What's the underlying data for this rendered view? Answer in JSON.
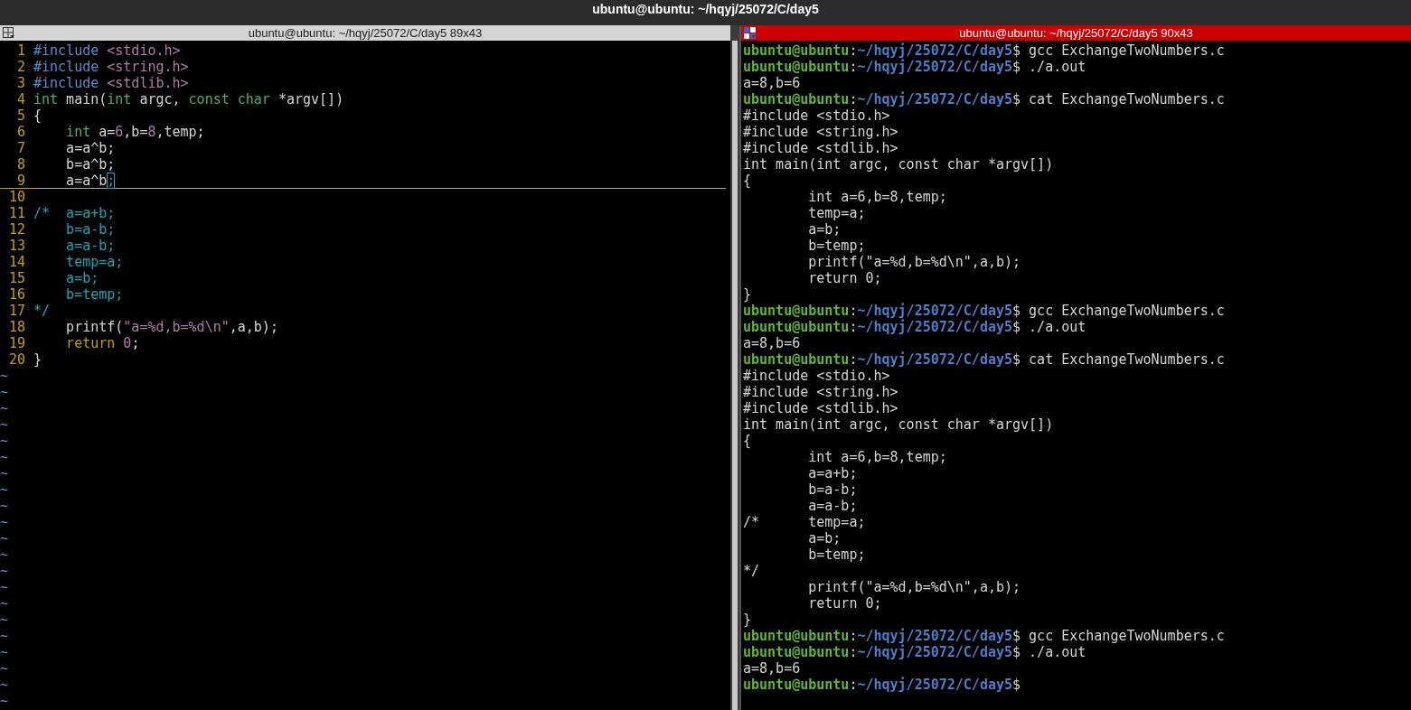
{
  "window": {
    "title": "ubuntu@ubuntu: ~/hqyj/25072/C/day5"
  },
  "panes": [
    {
      "kind": "editor",
      "title": "ubuntu@ubuntu: ~/hqyj/25072/C/day5 89x43",
      "active": false,
      "lines": [
        {
          "number": "1",
          "current": false,
          "segments": [
            {
              "text": "#include",
              "kind": "pre"
            },
            {
              "text": " <stdio.h>",
              "kind": "inc"
            }
          ]
        },
        {
          "number": "2",
          "current": false,
          "segments": [
            {
              "text": "#include",
              "kind": "pre"
            },
            {
              "text": " <string.h>",
              "kind": "inc"
            }
          ]
        },
        {
          "number": "3",
          "current": false,
          "segments": [
            {
              "text": "#include",
              "kind": "pre"
            },
            {
              "text": " <stdlib.h>",
              "kind": "inc"
            }
          ]
        },
        {
          "number": "4",
          "current": false,
          "segments": [
            {
              "text": "int",
              "kind": "type"
            },
            {
              "text": " main(",
              "kind": "plain"
            },
            {
              "text": "int",
              "kind": "type"
            },
            {
              "text": " argc, ",
              "kind": "plain"
            },
            {
              "text": "const char",
              "kind": "type"
            },
            {
              "text": " *argv[])",
              "kind": "plain"
            }
          ]
        },
        {
          "number": "5",
          "current": false,
          "segments": [
            {
              "text": "{",
              "kind": "plain"
            }
          ]
        },
        {
          "number": "6",
          "current": false,
          "segments": [
            {
              "text": "    int",
              "kind": "type"
            },
            {
              "text": " a=",
              "kind": "plain"
            },
            {
              "text": "6",
              "kind": "num"
            },
            {
              "text": ",b=",
              "kind": "plain"
            },
            {
              "text": "8",
              "kind": "num"
            },
            {
              "text": ",temp;",
              "kind": "plain"
            }
          ]
        },
        {
          "number": "7",
          "current": false,
          "segments": [
            {
              "text": "    a=a^b;",
              "kind": "plain"
            }
          ]
        },
        {
          "number": "8",
          "current": false,
          "segments": [
            {
              "text": "    b=a^b;",
              "kind": "plain"
            }
          ]
        },
        {
          "number": "9",
          "current": true,
          "segments": [
            {
              "text": "    a=a^b",
              "kind": "plain"
            },
            {
              "text": ";",
              "kind": "cursor"
            }
          ]
        },
        {
          "number": "10",
          "current": false
        },
        {
          "number": "11",
          "current": false,
          "segments": [
            {
              "text": "/*  a=a+b;",
              "kind": "cmt"
            }
          ]
        },
        {
          "number": "12",
          "current": false,
          "segments": [
            {
              "text": "    b=a-b;",
              "kind": "cmt"
            }
          ]
        },
        {
          "number": "13",
          "current": false,
          "segments": [
            {
              "text": "    a=a-b;",
              "kind": "cmt"
            }
          ]
        },
        {
          "number": "14",
          "current": false,
          "segments": [
            {
              "text": "    temp=a;",
              "kind": "cmt"
            }
          ]
        },
        {
          "number": "15",
          "current": false,
          "segments": [
            {
              "text": "    a=b;",
              "kind": "cmt"
            }
          ]
        },
        {
          "number": "16",
          "current": false,
          "segments": [
            {
              "text": "    b=temp;",
              "kind": "cmt"
            }
          ]
        },
        {
          "number": "17",
          "current": false,
          "segments": [
            {
              "text": "*/",
              "kind": "cmt"
            }
          ]
        },
        {
          "number": "18",
          "current": false,
          "segments": [
            {
              "text": "    printf(",
              "kind": "plain"
            },
            {
              "text": "\"a=%d,b=%d\\n\"",
              "kind": "num"
            },
            {
              "text": ",a,b);",
              "kind": "plain"
            }
          ]
        },
        {
          "number": "19",
          "current": false,
          "segments": [
            {
              "text": "    return",
              "kind": "stmt"
            },
            {
              "text": " 0",
              "kind": "num"
            },
            {
              "text": ";",
              "kind": "plain"
            }
          ]
        },
        {
          "number": "20",
          "current": false,
          "segments": [
            {
              "text": "}",
              "kind": "plain"
            }
          ]
        }
      ],
      "filler": [
        "~",
        "~",
        "~",
        "~",
        "~",
        "~",
        "~",
        "~",
        "~",
        "~",
        "~",
        "~",
        "~",
        "~",
        "~",
        "~",
        "~",
        "~",
        "~",
        "~",
        "~"
      ]
    },
    {
      "kind": "terminal",
      "title": "ubuntu@ubuntu: ~/hqyj/25072/C/day5 90x43",
      "active": true,
      "lines": [
        {
          "segments": [
            {
              "text": "ubuntu@ubuntu",
              "kind": "user"
            },
            {
              "text": ":",
              "kind": "plain"
            },
            {
              "text": "~/hqyj/25072/C/day5",
              "kind": "path"
            },
            {
              "text": "$ gcc ExchangeTwoNumbers.c",
              "kind": "plain"
            }
          ]
        },
        {
          "segments": [
            {
              "text": "ubuntu@ubuntu",
              "kind": "user"
            },
            {
              "text": ":",
              "kind": "plain"
            },
            {
              "text": "~/hqyj/25072/C/day5",
              "kind": "path"
            },
            {
              "text": "$ ./a.out",
              "kind": "plain"
            }
          ]
        },
        {
          "segments": [
            {
              "text": "a=8,b=6",
              "kind": "plain"
            }
          ]
        },
        {
          "segments": [
            {
              "text": "ubuntu@ubuntu",
              "kind": "user"
            },
            {
              "text": ":",
              "kind": "plain"
            },
            {
              "text": "~/hqyj/25072/C/day5",
              "kind": "path"
            },
            {
              "text": "$ cat ExchangeTwoNumbers.c",
              "kind": "plain"
            }
          ]
        },
        {
          "segments": [
            {
              "text": "#include <stdio.h>",
              "kind": "plain"
            }
          ]
        },
        {
          "segments": [
            {
              "text": "#include <string.h>",
              "kind": "plain"
            }
          ]
        },
        {
          "segments": [
            {
              "text": "#include <stdlib.h>",
              "kind": "plain"
            }
          ]
        },
        {
          "segments": [
            {
              "text": "int main(int argc, const char *argv[])",
              "kind": "plain"
            }
          ]
        },
        {
          "segments": [
            {
              "text": "{",
              "kind": "plain"
            }
          ]
        },
        {
          "segments": [
            {
              "text": "        int a=6,b=8,temp;",
              "kind": "plain"
            }
          ]
        },
        {
          "segments": [
            {
              "text": "        temp=a;",
              "kind": "plain"
            }
          ]
        },
        {
          "segments": [
            {
              "text": "        a=b;",
              "kind": "plain"
            }
          ]
        },
        {
          "segments": [
            {
              "text": "        b=temp;",
              "kind": "plain"
            }
          ]
        },
        {
          "segments": [
            {
              "text": "        printf(\"a=%d,b=%d\\n\",a,b);",
              "kind": "plain"
            }
          ]
        },
        {
          "segments": [
            {
              "text": "        return 0;",
              "kind": "plain"
            }
          ]
        },
        {
          "segments": [
            {
              "text": "}",
              "kind": "plain"
            }
          ]
        },
        {
          "segments": [
            {
              "text": "ubuntu@ubuntu",
              "kind": "user"
            },
            {
              "text": ":",
              "kind": "plain"
            },
            {
              "text": "~/hqyj/25072/C/day5",
              "kind": "path"
            },
            {
              "text": "$ gcc ExchangeTwoNumbers.c",
              "kind": "plain"
            }
          ]
        },
        {
          "segments": [
            {
              "text": "ubuntu@ubuntu",
              "kind": "user"
            },
            {
              "text": ":",
              "kind": "plain"
            },
            {
              "text": "~/hqyj/25072/C/day5",
              "kind": "path"
            },
            {
              "text": "$ ./a.out",
              "kind": "plain"
            }
          ]
        },
        {
          "segments": [
            {
              "text": "a=8,b=6",
              "kind": "plain"
            }
          ]
        },
        {
          "segments": [
            {
              "text": "ubuntu@ubuntu",
              "kind": "user"
            },
            {
              "text": ":",
              "kind": "plain"
            },
            {
              "text": "~/hqyj/25072/C/day5",
              "kind": "path"
            },
            {
              "text": "$ cat ExchangeTwoNumbers.c",
              "kind": "plain"
            }
          ]
        },
        {
          "segments": [
            {
              "text": "#include <stdio.h>",
              "kind": "plain"
            }
          ]
        },
        {
          "segments": [
            {
              "text": "#include <string.h>",
              "kind": "plain"
            }
          ]
        },
        {
          "segments": [
            {
              "text": "#include <stdlib.h>",
              "kind": "plain"
            }
          ]
        },
        {
          "segments": [
            {
              "text": "int main(int argc, const char *argv[])",
              "kind": "plain"
            }
          ]
        },
        {
          "segments": [
            {
              "text": "{",
              "kind": "plain"
            }
          ]
        },
        {
          "segments": [
            {
              "text": "        int a=6,b=8,temp;",
              "kind": "plain"
            }
          ]
        },
        {
          "segments": [
            {
              "text": "        a=a+b;",
              "kind": "plain"
            }
          ]
        },
        {
          "segments": [
            {
              "text": "        b=a-b;",
              "kind": "plain"
            }
          ]
        },
        {
          "segments": [
            {
              "text": "        a=a-b;",
              "kind": "plain"
            }
          ]
        },
        {
          "segments": [
            {
              "text": "/*      temp=a;",
              "kind": "plain"
            }
          ]
        },
        {
          "segments": [
            {
              "text": "        a=b;",
              "kind": "plain"
            }
          ]
        },
        {
          "segments": [
            {
              "text": "        b=temp;",
              "kind": "plain"
            }
          ]
        },
        {
          "segments": [
            {
              "text": "*/",
              "kind": "plain"
            }
          ]
        },
        {
          "segments": [
            {
              "text": "        printf(\"a=%d,b=%d\\n\",a,b);",
              "kind": "plain"
            }
          ]
        },
        {
          "segments": [
            {
              "text": "        return 0;",
              "kind": "plain"
            }
          ]
        },
        {
          "segments": [
            {
              "text": "}",
              "kind": "plain"
            }
          ]
        },
        {
          "segments": [
            {
              "text": "ubuntu@ubuntu",
              "kind": "user"
            },
            {
              "text": ":",
              "kind": "plain"
            },
            {
              "text": "~/hqyj/25072/C/day5",
              "kind": "path"
            },
            {
              "text": "$ gcc ExchangeTwoNumbers.c",
              "kind": "plain"
            }
          ]
        },
        {
          "segments": [
            {
              "text": "ubuntu@ubuntu",
              "kind": "user"
            },
            {
              "text": ":",
              "kind": "plain"
            },
            {
              "text": "~/hqyj/25072/C/day5",
              "kind": "path"
            },
            {
              "text": "$ ./a.out",
              "kind": "plain"
            }
          ]
        },
        {
          "segments": [
            {
              "text": "a=8,b=6",
              "kind": "plain"
            }
          ]
        },
        {
          "segments": [
            {
              "text": "ubuntu@ubuntu",
              "kind": "user"
            },
            {
              "text": ":",
              "kind": "plain"
            },
            {
              "text": "~/hqyj/25072/C/day5",
              "kind": "path"
            },
            {
              "text": "$",
              "kind": "plain"
            }
          ]
        }
      ]
    }
  ]
}
